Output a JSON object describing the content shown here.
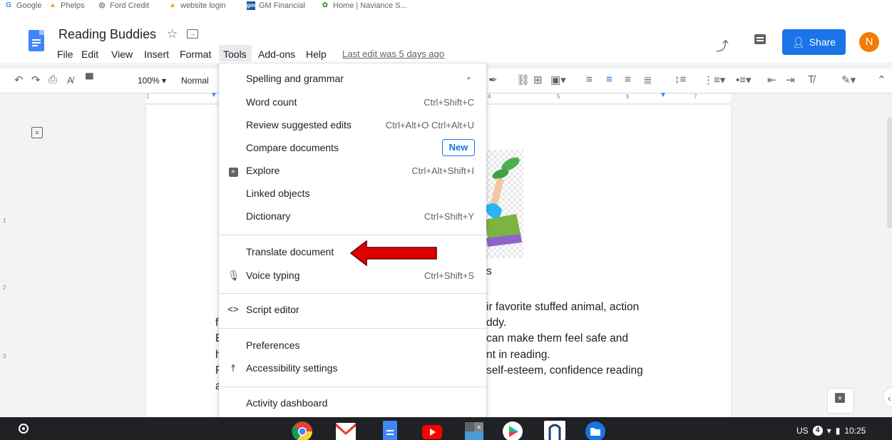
{
  "bookmarks": [
    {
      "label": "Google",
      "icon": "google-icon",
      "color": "#4285f4"
    },
    {
      "label": "Phelps",
      "icon": "phelps-icon",
      "color": "#f9a825"
    },
    {
      "label": "Ford Credit",
      "icon": "globe-icon",
      "color": "#5f6368"
    },
    {
      "label": "website login",
      "icon": "website-icon",
      "color": "#f9a825"
    },
    {
      "label": "GM Financial",
      "icon": "gm-icon",
      "color": "#1a56a5"
    },
    {
      "label": "Home | Naviance S...",
      "icon": "naviance-icon",
      "color": "#43a047"
    }
  ],
  "doc": {
    "title": "Reading Buddies",
    "last_edit": "Last edit was 5 days ago"
  },
  "menubar": [
    "File",
    "Edit",
    "View",
    "Insert",
    "Format",
    "Tools",
    "Add-ons",
    "Help"
  ],
  "header": {
    "share_label": "Share",
    "avatar_initial": "N"
  },
  "toolbar": {
    "zoom": "100%",
    "style": "Normal"
  },
  "ruler": {
    "marks": [
      "1",
      "4",
      "5",
      "6",
      "7"
    ]
  },
  "vruler": {
    "marks": [
      "1",
      "2",
      "3"
    ]
  },
  "tools_menu": {
    "items": [
      {
        "label": "Spelling and grammar",
        "shortcut": "",
        "icon": "",
        "submenu": true
      },
      {
        "label": "Word count",
        "shortcut": "Ctrl+Shift+C",
        "icon": ""
      },
      {
        "label": "Review suggested edits",
        "shortcut": "Ctrl+Alt+O Ctrl+Alt+U",
        "icon": ""
      },
      {
        "label": "Compare documents",
        "shortcut": "",
        "icon": "",
        "badge": "New"
      },
      {
        "label": "Explore",
        "shortcut": "Ctrl+Alt+Shift+I",
        "icon": "explore-icon"
      },
      {
        "label": "Linked objects",
        "shortcut": "",
        "icon": ""
      },
      {
        "label": "Dictionary",
        "shortcut": "Ctrl+Shift+Y",
        "icon": ""
      },
      {
        "label": "Translate document",
        "shortcut": "",
        "icon": ""
      },
      {
        "label": "Voice typing",
        "shortcut": "Ctrl+Shift+S",
        "icon": "microphone-icon"
      },
      {
        "label": "Script editor",
        "shortcut": "",
        "icon": "code-icon"
      },
      {
        "label": "Preferences",
        "shortcut": "",
        "icon": ""
      },
      {
        "label": "Accessibility settings",
        "shortcut": "",
        "icon": "accessibility-icon"
      },
      {
        "label": "Activity dashboard",
        "shortcut": "",
        "icon": ""
      }
    ]
  },
  "document_text": {
    "heading_fragment": "s",
    "lines": [
      "ir favorite stuffed animal, action",
      "ddy.",
      "can make them feel safe and",
      "nt in reading.",
      "self-esteem, confidence reading"
    ],
    "left_fragments": [
      "f",
      "E",
      "h",
      "F",
      "a"
    ]
  },
  "tray": {
    "region": "US",
    "notifications": "4",
    "time": "10:25"
  },
  "colors": {
    "accent": "#1a73e8",
    "arrow": "#e00000",
    "avatar": "#f57c00"
  }
}
